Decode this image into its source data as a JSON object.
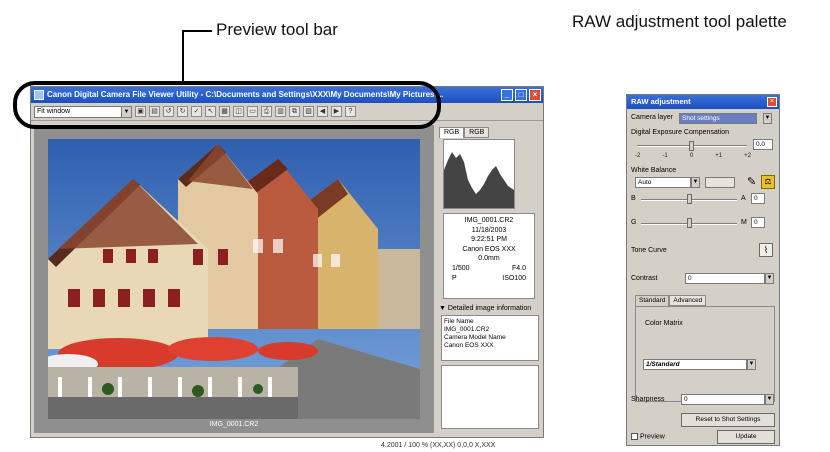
{
  "callouts": {
    "preview_toolbar": "Preview tool bar",
    "raw_palette": "RAW adjustment tool palette"
  },
  "main_window": {
    "title": "Canon Digital Camera File Viewer Utility - C:\\Documents and Settings\\XXX\\My Documents\\My Pictures\\...",
    "zoom_select": "Fit window",
    "histogram_tabs": [
      "RGB",
      "RGB"
    ],
    "info_lines": [
      "IMG_0001.CR2",
      "11/18/2003",
      "9:22:51 PM",
      "Canon EOS XXX",
      "0.0mm"
    ],
    "shutter": "1/500",
    "aperture": "F4.0",
    "mode": "P",
    "iso": "ISO100",
    "detail_header": "Detailed image information",
    "detail_lines": [
      "File Name",
      "IMG_0001.CR2",
      "Camera Model Name",
      "Canon EOS XXX"
    ],
    "filename_label": "IMG_0001.CR2",
    "status_text": "4.2001 / 100 % (XX,XX) 0,0,0 X,XXX"
  },
  "palette": {
    "title": "RAW adjustment",
    "camera_label": "Camera layer",
    "camera_value": "Shot settings",
    "dec_label": "Digital Exposure Compensation",
    "dec_value": "0.0",
    "dec_ticks": [
      "-2",
      "-1",
      "0",
      "+1",
      "+2"
    ],
    "wb_label": "White Balance",
    "wb_value": "Auto",
    "wb_b": "B",
    "wb_a": "A",
    "wb_g": "G",
    "wb_m": "M",
    "wb_val1": "0",
    "wb_val2": "0",
    "tone_label": "Tone Curve",
    "contrast_label": "Contrast",
    "contrast_value": "0",
    "tab_standard": "Standard",
    "tab_advanced": "Advanced",
    "color_matrix_label": "Color Matrix",
    "color_matrix_value": "1/Standard",
    "sharpness_label": "Sharpness",
    "sharpness_value": "0",
    "reset_button": "Reset to Shot Settings",
    "preview_label": "Preview",
    "update_button": "Update"
  }
}
